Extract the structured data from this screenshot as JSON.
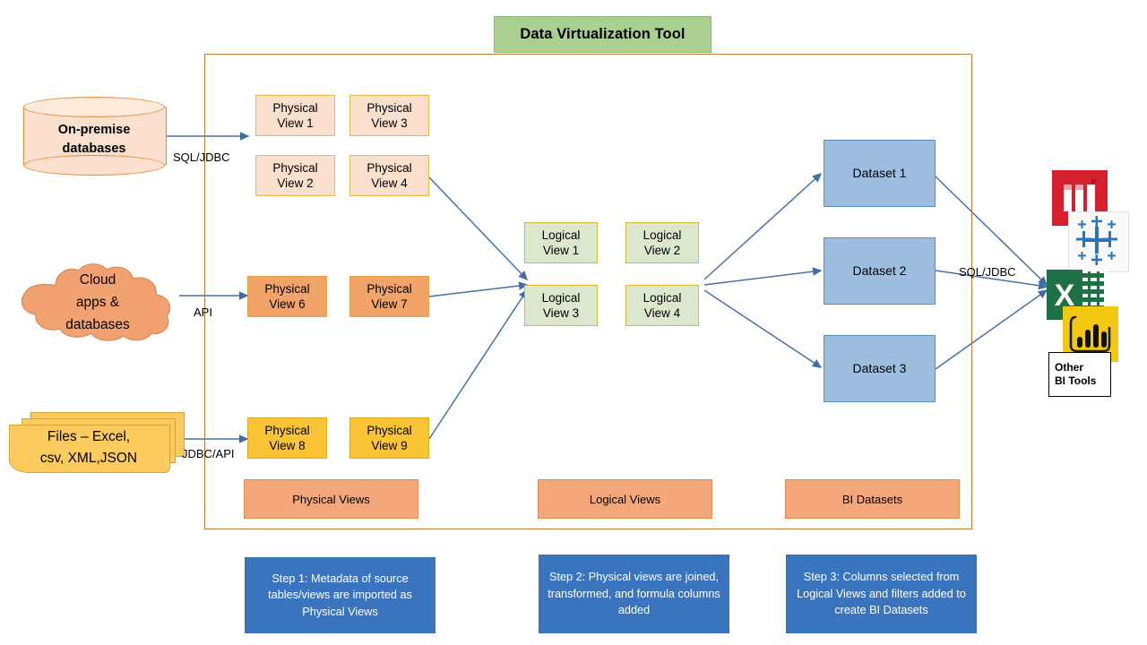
{
  "title": {
    "label": "Data Virtualization Tool"
  },
  "sources": [
    {
      "name": "on-premise-databases",
      "lines": [
        "On-premise",
        "databases"
      ],
      "shape": "cylinder",
      "connector_label": "SQL/JDBC"
    },
    {
      "name": "cloud-apps-databases",
      "lines": [
        "Cloud",
        "apps &",
        "databases"
      ],
      "shape": "cloud",
      "connector_label": "API"
    },
    {
      "name": "files",
      "lines": [
        "Files – Excel,",
        "csv, XML,JSON"
      ],
      "shape": "documents",
      "connector_label": "JDBC/API"
    }
  ],
  "physical_views": [
    {
      "lines": [
        "Physical",
        "View 1"
      ],
      "style": "peach"
    },
    {
      "lines": [
        "Physical",
        "View 3"
      ],
      "style": "peach"
    },
    {
      "lines": [
        "Physical",
        "View 2"
      ],
      "style": "peach"
    },
    {
      "lines": [
        "Physical",
        "View 4"
      ],
      "style": "peach"
    },
    {
      "lines": [
        "Physical",
        "View 6"
      ],
      "style": "salmon"
    },
    {
      "lines": [
        "Physical",
        "View 7"
      ],
      "style": "salmon"
    },
    {
      "lines": [
        "Physical",
        "View 8"
      ],
      "style": "gold"
    },
    {
      "lines": [
        "Physical",
        "View 9"
      ],
      "style": "gold"
    }
  ],
  "logical_views": [
    {
      "lines": [
        "Logical",
        "View 1"
      ]
    },
    {
      "lines": [
        "Logical",
        "View 2"
      ]
    },
    {
      "lines": [
        "Logical",
        "View 3"
      ]
    },
    {
      "lines": [
        "Logical",
        "View 4"
      ]
    }
  ],
  "datasets": [
    {
      "label": "Dataset 1"
    },
    {
      "label": "Dataset 2"
    },
    {
      "label": "Dataset 3"
    }
  ],
  "dataset_to_bi_label": "SQL/JDBC",
  "legend": [
    {
      "label": "Physical Views"
    },
    {
      "label": "Logical Views"
    },
    {
      "label": "BI Datasets"
    }
  ],
  "steps": [
    {
      "text": "Step 1:  Metadata of source tables/views are imported  as Physical Views"
    },
    {
      "text": "Step 2: Physical views are joined, transformed,  and formula  columns added"
    },
    {
      "text": "Step 3:  Columns selected from Logical Views and filters added to create BI Datasets"
    }
  ],
  "bi_tools": [
    {
      "name": "microstrategy-icon"
    },
    {
      "name": "tableau-icon"
    },
    {
      "name": "excel-icon"
    },
    {
      "name": "power-bi-icon"
    },
    {
      "name": "other-bi-tools",
      "lines": [
        "Other",
        "BI Tools"
      ]
    }
  ],
  "colors": {
    "title_fill": "#A9CF91",
    "container_border": "#C07A33",
    "physical_peach": "#FBE0CE",
    "physical_salmon": "#F2A368",
    "physical_gold": "#FBC435",
    "logical_green": "#DCE8CE",
    "dataset_blue": "#9EBEE0",
    "legend_fill": "#F3A77A",
    "step_fill": "#3A74BF",
    "arrow": "#4472A8"
  }
}
